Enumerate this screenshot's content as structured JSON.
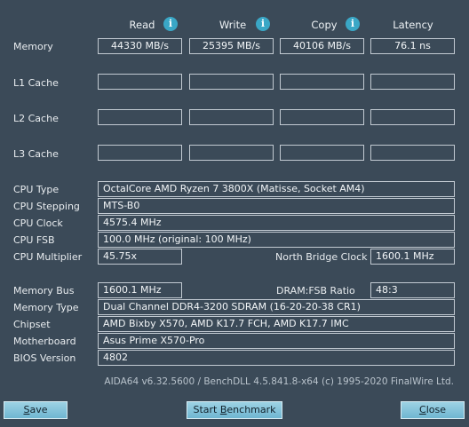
{
  "headers": {
    "read": "Read",
    "write": "Write",
    "copy": "Copy",
    "latency": "Latency"
  },
  "info_icon_glyph": "i",
  "rows": {
    "memory": {
      "label": "Memory",
      "read": "44330 MB/s",
      "write": "25395 MB/s",
      "copy": "40106 MB/s",
      "latency": "76.1 ns"
    },
    "l1": {
      "label": "L1 Cache"
    },
    "l2": {
      "label": "L2 Cache"
    },
    "l3": {
      "label": "L3 Cache"
    }
  },
  "cpu": {
    "type_label": "CPU Type",
    "type_value": "OctalCore AMD Ryzen 7 3800X  (Matisse, Socket AM4)",
    "stepping_label": "CPU Stepping",
    "stepping_value": "MTS-B0",
    "clock_label": "CPU Clock",
    "clock_value": "4575.4 MHz",
    "fsb_label": "CPU FSB",
    "fsb_value": "100.0 MHz  (original: 100 MHz)",
    "multiplier_label": "CPU Multiplier",
    "multiplier_value": "45.75x",
    "nb_clock_label": "North Bridge Clock",
    "nb_clock_value": "1600.1 MHz"
  },
  "memory_info": {
    "bus_label": "Memory Bus",
    "bus_value": "1600.1 MHz",
    "ratio_label": "DRAM:FSB Ratio",
    "ratio_value": "48:3",
    "type_label": "Memory Type",
    "type_value": "Dual Channel DDR4-3200 SDRAM  (16-20-20-38 CR1)",
    "chipset_label": "Chipset",
    "chipset_value": "AMD Bixby X570, AMD K17.7 FCH, AMD K17.7 IMC",
    "motherboard_label": "Motherboard",
    "motherboard_value": "Asus Prime X570-Pro",
    "bios_label": "BIOS Version",
    "bios_value": "4802"
  },
  "footer_text": "AIDA64 v6.32.5600 / BenchDLL 4.5.841.8-x64  (c) 1995-2020 FinalWire Ltd.",
  "buttons": {
    "save_first": "S",
    "save_rest": "ave",
    "start_pre": "Start ",
    "start_ul": "B",
    "start_post": "enchmark",
    "close_first": "C",
    "close_rest": "lose"
  },
  "colors": {
    "background": "#3b4a58",
    "button": "#8cc8de",
    "info_icon": "#3aa7c6"
  }
}
